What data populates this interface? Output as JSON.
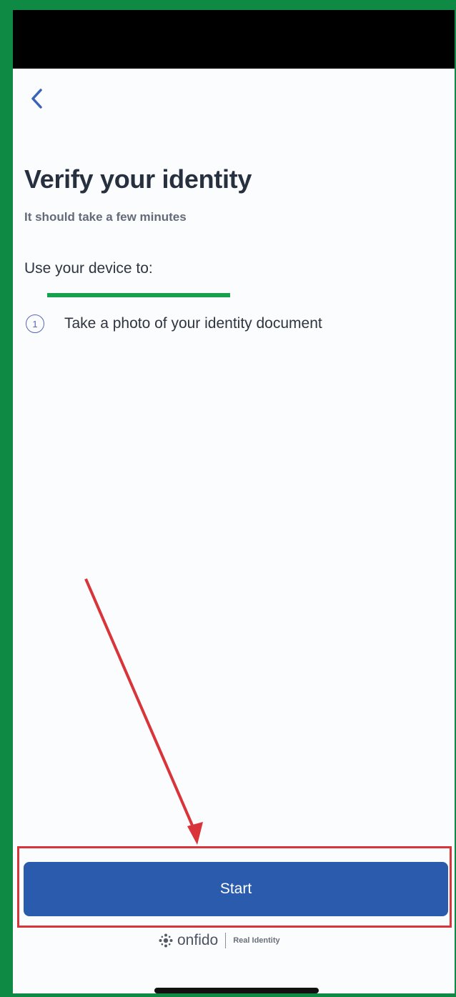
{
  "header": {
    "back_icon": "chevron-left-icon"
  },
  "main": {
    "title": "Verify your identity",
    "subtitle": "It should take a few minutes",
    "section_heading": "Use your device to:",
    "steps": [
      {
        "number": "1",
        "label": "Take a photo of your identity document"
      }
    ]
  },
  "actions": {
    "start_label": "Start"
  },
  "footer": {
    "brand_name": "onfido",
    "brand_tagline": "Real Identity"
  },
  "colors": {
    "primary_button": "#2a5bac",
    "annotation_red": "#d9343a",
    "annotation_green": "#17a14e",
    "frame_green": "#0e8a45"
  }
}
